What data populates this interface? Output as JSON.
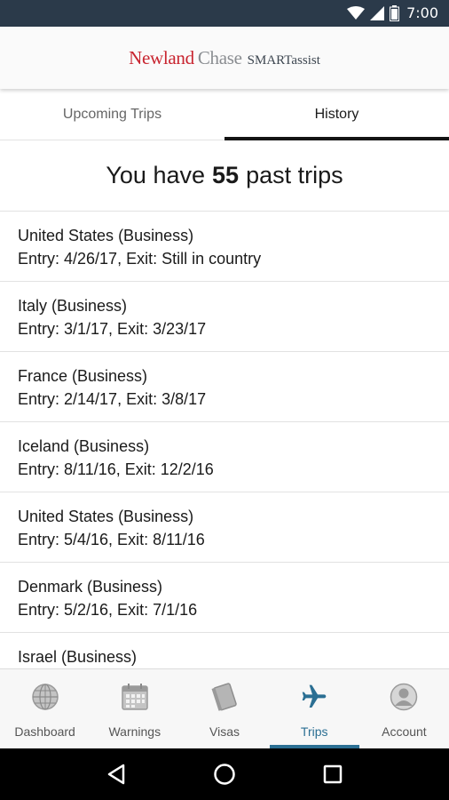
{
  "status_bar": {
    "time": "7:00"
  },
  "header": {
    "logo_part1": "Newland",
    "logo_part2": "Chase",
    "logo_part3": "SMARTassist"
  },
  "tabs": [
    {
      "label": "Upcoming Trips",
      "active": false
    },
    {
      "label": "History",
      "active": true
    }
  ],
  "summary": {
    "prefix": "You have",
    "count": "55",
    "suffix": "past trips"
  },
  "trips": [
    {
      "country": "United States (Business)",
      "dates": "Entry: 4/26/17, Exit: Still in country"
    },
    {
      "country": "Italy (Business)",
      "dates": "Entry: 3/1/17, Exit: 3/23/17"
    },
    {
      "country": "France (Business)",
      "dates": "Entry: 2/14/17, Exit: 3/8/17"
    },
    {
      "country": "Iceland (Business)",
      "dates": "Entry: 8/11/16, Exit: 12/2/16"
    },
    {
      "country": "United States (Business)",
      "dates": "Entry: 5/4/16, Exit: 8/11/16"
    },
    {
      "country": "Denmark (Business)",
      "dates": "Entry: 5/2/16, Exit: 7/1/16"
    },
    {
      "country": "Israel (Business)",
      "dates": ""
    }
  ],
  "bottom_nav": [
    {
      "label": "Dashboard",
      "icon": "globe-icon",
      "active": false
    },
    {
      "label": "Warnings",
      "icon": "calendar-icon",
      "active": false
    },
    {
      "label": "Visas",
      "icon": "passport-icon",
      "active": false
    },
    {
      "label": "Trips",
      "icon": "airplane-icon",
      "active": true
    },
    {
      "label": "Account",
      "icon": "user-icon",
      "active": false
    }
  ],
  "colors": {
    "brand_red": "#c8242f",
    "active_blue": "#2b6f93",
    "status_bar": "#2b3a4a"
  }
}
